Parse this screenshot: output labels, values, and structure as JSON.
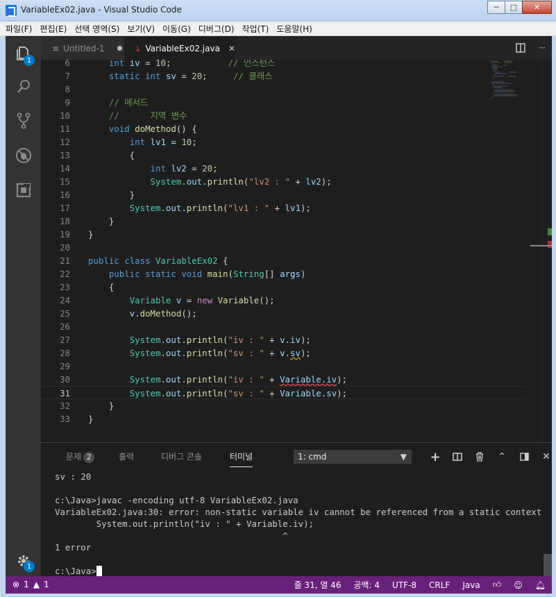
{
  "window": {
    "title": "VariableEx02.java - Visual Studio Code",
    "buttons": [
      "─",
      "□",
      "✕"
    ]
  },
  "menu": [
    "파일(F)",
    "편집(E)",
    "선택 영역(S)",
    "보기(V)",
    "이동(G)",
    "디버그(D)",
    "작업(T)",
    "도움말(H)"
  ],
  "activity": {
    "explorer_badge": "1",
    "settings_badge": "1"
  },
  "tabs": [
    {
      "label": "Untitled-1",
      "icon": "file-lines-icon"
    },
    {
      "label": "VariableEx02.java",
      "icon": "java-icon"
    }
  ],
  "editor": {
    "current_line": 31,
    "lines": [
      {
        "n": "6",
        "html": "    <span class='kw'>int</span> <span class='vr'>iv</span> = <span class='nm'>10</span>;           <span class='cm'>// 인스턴스</span>"
      },
      {
        "n": "7",
        "html": "    <span class='kw'>static</span> <span class='kw'>int</span> <span class='vr'>sv</span> = <span class='nm'>20</span>;     <span class='cm'>// 클래스</span>"
      },
      {
        "n": "8",
        "html": ""
      },
      {
        "n": "9",
        "html": "    <span class='cm'>// 메서드</span>"
      },
      {
        "n": "10",
        "html": "    <span class='cm'>//      지역 변수</span>"
      },
      {
        "n": "11",
        "html": "    <span class='kw'>void</span> <span class='fn'>doMethod</span>() {"
      },
      {
        "n": "12",
        "html": "        <span class='kw'>int</span> <span class='vr'>lv1</span> = <span class='nm'>10</span>;"
      },
      {
        "n": "13",
        "html": "        {"
      },
      {
        "n": "14",
        "html": "            <span class='kw'>int</span> <span class='vr'>lv2</span> = <span class='nm'>20</span>;"
      },
      {
        "n": "15",
        "html": "            <span class='ty'>System</span>.<span class='vr'>out</span>.<span class='fn'>println</span>(<span class='st'>\"lv2 : \"</span> + <span class='vr'>lv2</span>);"
      },
      {
        "n": "16",
        "html": "        }"
      },
      {
        "n": "17",
        "html": "        <span class='ty'>System</span>.<span class='vr'>out</span>.<span class='fn'>println</span>(<span class='st'>\"lv1 : \"</span> + <span class='vr'>lv1</span>);"
      },
      {
        "n": "18",
        "html": "    }"
      },
      {
        "n": "19",
        "html": "}"
      },
      {
        "n": "20",
        "html": ""
      },
      {
        "n": "21",
        "html": "<span class='kw'>public</span> <span class='kw'>class</span> <span class='ty'>VariableEx02</span> {"
      },
      {
        "n": "22",
        "html": "    <span class='kw'>public</span> <span class='kw'>static</span> <span class='kw'>void</span> <span class='fn'>main</span>(<span class='ty'>String</span>[] <span class='vr'>args</span>)"
      },
      {
        "n": "23",
        "html": "    {"
      },
      {
        "n": "24",
        "html": "        <span class='ty'>Variable</span> <span class='vr'>v</span> = <span class='ct'>new</span> <span class='fn'>Variable</span>();"
      },
      {
        "n": "25",
        "html": "        <span class='vr'>v</span>.<span class='fn'>doMethod</span>();"
      },
      {
        "n": "26",
        "html": ""
      },
      {
        "n": "27",
        "html": "        <span class='ty'>System</span>.<span class='vr'>out</span>.<span class='fn'>println</span>(<span class='st'>\"iv : \"</span> + <span class='vr'>v</span>.<span class='vr'>iv</span>);"
      },
      {
        "n": "28",
        "html": "        <span class='ty'>System</span>.<span class='vr'>out</span>.<span class='fn'>println</span>(<span class='st'>\"sv : \"</span> + <span class='vr'>v</span>.<span class='vr sqg'>sv</span>);"
      },
      {
        "n": "29",
        "html": ""
      },
      {
        "n": "30",
        "html": "        <span class='ty'>System</span>.<span class='vr'>out</span>.<span class='fn'>println</span>(<span class='st'>\"iv : \"</span> + <span class='vr sq'>Variable.iv</span>);"
      },
      {
        "n": "31",
        "html": "        <span class='ty'>System</span>.<span class='vr'>out</span>.<span class='fn'>println</span>(<span class='st'>\"sv : \"</span> + <span class='vr'>Variable</span>.<span class='vr'>sv</span>);"
      },
      {
        "n": "32",
        "html": "    }"
      },
      {
        "n": "33",
        "html": "}"
      }
    ]
  },
  "panel": {
    "tabs": [
      {
        "label": "문제",
        "count": "2"
      },
      {
        "label": "출력"
      },
      {
        "label": "디버그 콘솔"
      },
      {
        "label": "터미널"
      }
    ],
    "terminal_select": "1: cmd",
    "terminal_lines": [
      "sv : 20",
      "",
      "c:\\Java>javac -encoding utf-8 VariableEx02.java",
      "VariableEx02.java:30: error: non-static variable iv cannot be referenced from a static context",
      "        System.out.println(\"iv : \" + Variable.iv);",
      "                                            ^",
      "1 error",
      ""
    ],
    "prompt": "c:\\Java>"
  },
  "status": {
    "errors": "1",
    "warnings": "1",
    "position": "줄 31, 열 46",
    "spaces": "공백: 4",
    "encoding": "UTF-8",
    "eol": "CRLF",
    "language": "Java",
    "accent": "#68217a"
  }
}
